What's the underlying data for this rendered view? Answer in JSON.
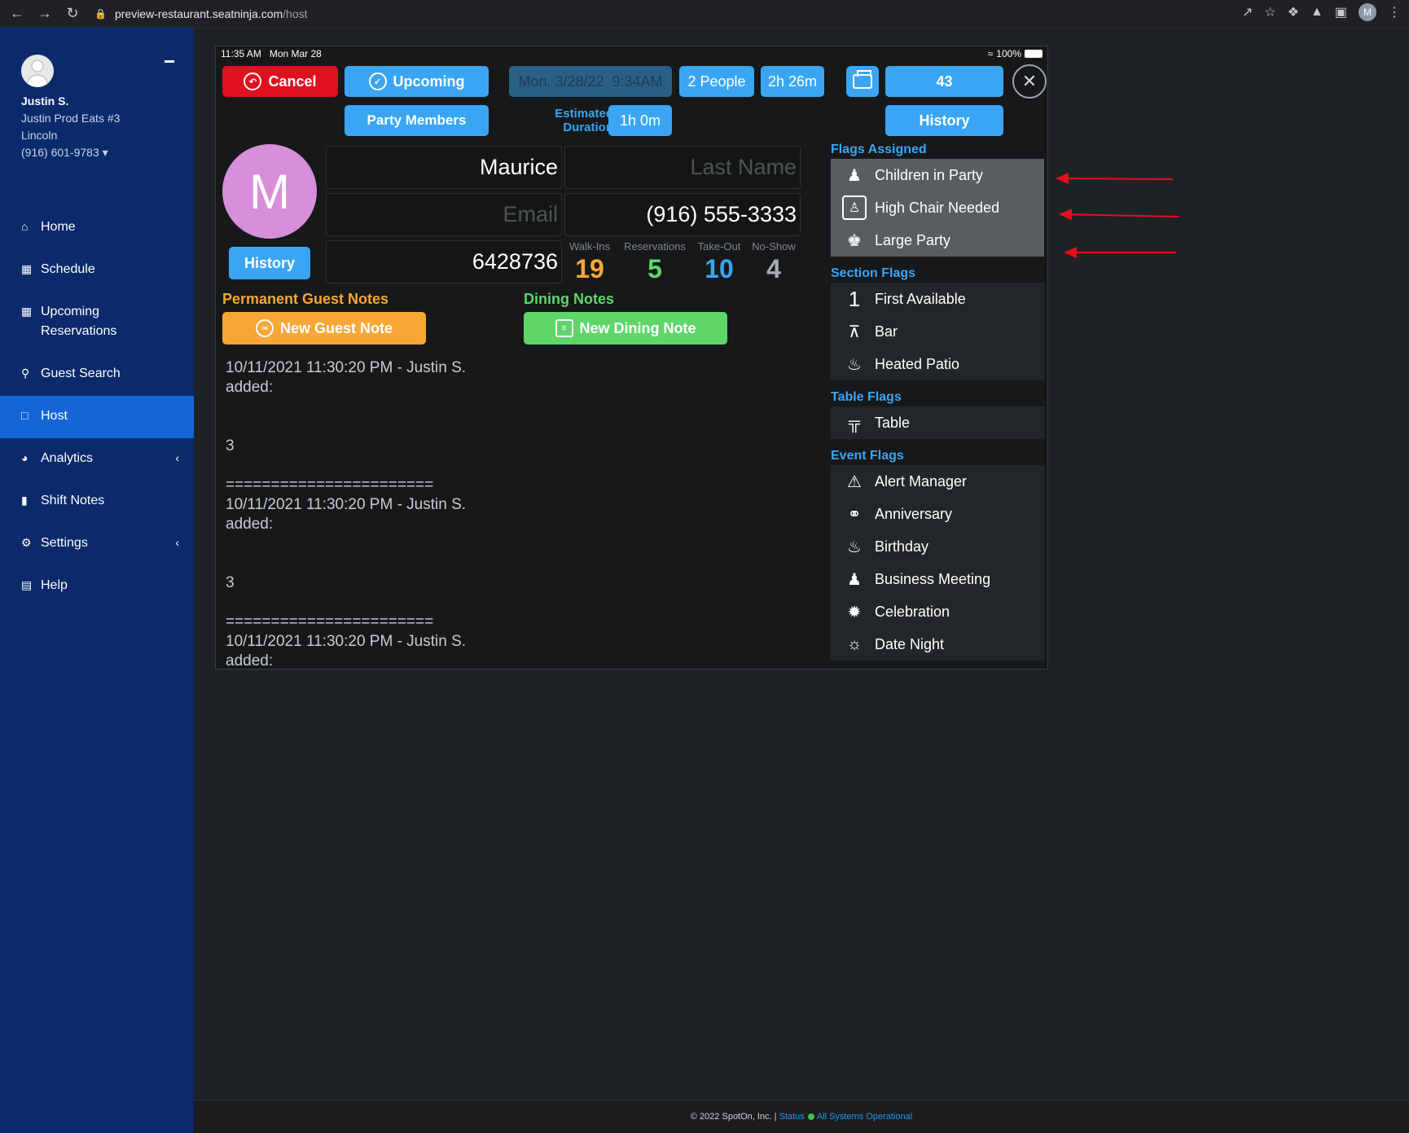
{
  "browser": {
    "url_host": "preview-restaurant.seatninja.com",
    "url_path": "/host",
    "profile_initial": "M"
  },
  "sidebar": {
    "user_name": "Justin S.",
    "restaurant": "Justin Prod Eats #3",
    "city": "Lincoln",
    "phone": "(916) 601-9783",
    "items": [
      {
        "label": "Home",
        "icon": "home-icon"
      },
      {
        "label": "Schedule",
        "icon": "calendar-icon"
      },
      {
        "label": "Upcoming Reservations",
        "icon": "calendar-icon"
      },
      {
        "label": "Guest Search",
        "icon": "search-icon"
      },
      {
        "label": "Host",
        "icon": "square-icon"
      },
      {
        "label": "Analytics",
        "icon": "pie-chart-icon"
      },
      {
        "label": "Shift Notes",
        "icon": "note-icon"
      },
      {
        "label": "Settings",
        "icon": "gear-icon"
      },
      {
        "label": "Help",
        "icon": "book-icon"
      }
    ]
  },
  "status": {
    "time": "11:35 AM",
    "date": "Mon Mar 28",
    "battery": "100%"
  },
  "toolbar": {
    "cancel": "Cancel",
    "upcoming": "Upcoming",
    "party_members": "Party Members",
    "datetime": "Mon. 3/28/22  9:34AM",
    "people": "2 People",
    "elapsed": "2h 26m",
    "est_label": "Estimated Duration",
    "est_value": "1h 0m",
    "count": "43",
    "history": "History"
  },
  "guest": {
    "initial": "M",
    "history_btn": "History",
    "first_name": "Maurice",
    "last_name_placeholder": "Last Name",
    "email_placeholder": "Email",
    "phone": "(916) 555-3333",
    "id": "6428736"
  },
  "stats": [
    {
      "label": "Walk-Ins",
      "value": "19",
      "color": "#f6a735"
    },
    {
      "label": "Reservations",
      "value": "5",
      "color": "#5ed66a"
    },
    {
      "label": "Take-Out",
      "value": "10",
      "color": "#3aa6f3"
    },
    {
      "label": "No-Show",
      "value": "4",
      "color": "#a8adb1"
    }
  ],
  "notes": {
    "guest_heading": "Permanent Guest Notes",
    "dining_heading": "Dining Notes",
    "new_guest_note": "New Guest Note",
    "new_dining_note": "New Dining Note",
    "text": "10/11/2021 11:30:20 PM - Justin S. added:\n\n\n3\n\n=======================\n10/11/2021 11:30:20 PM - Justin S. added:\n\n\n3\n\n=======================\n10/11/2021 11:30:20 PM - Justin S. added:"
  },
  "flags": {
    "assigned_heading": "Flags Assigned",
    "assigned": [
      "Children in Party",
      "High Chair Needed",
      "Large Party"
    ],
    "section_heading": "Section Flags",
    "section": [
      "First Available",
      "Bar",
      "Heated Patio"
    ],
    "table_heading": "Table Flags",
    "table": [
      "Table"
    ],
    "event_heading": "Event Flags",
    "event": [
      "Alert Manager",
      "Anniversary",
      "Birthday",
      "Business Meeting",
      "Celebration",
      "Date Night"
    ]
  },
  "footer": {
    "copyright": "© 2022 SpotOn, Inc. |",
    "status_link": "Status",
    "systems": "All Systems Operational"
  },
  "colors": {
    "sidebar": "#0b2a6b",
    "active": "#1565d8",
    "accent_blue": "#3aa6f3",
    "cancel_red": "#e0101f",
    "annotation_red": "#e5101c"
  }
}
